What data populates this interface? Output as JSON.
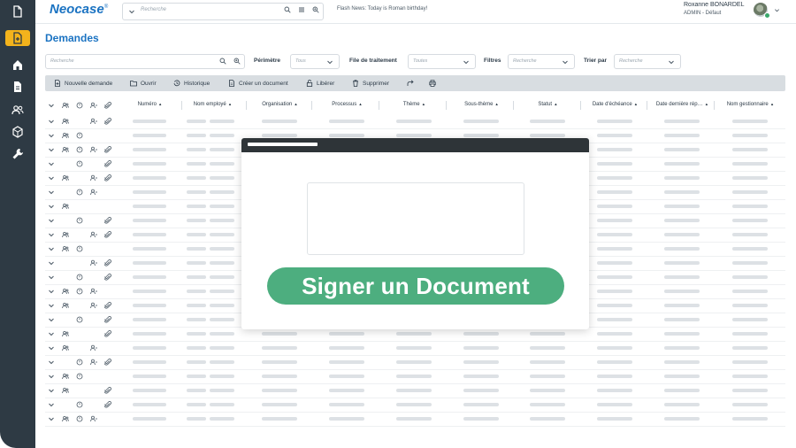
{
  "app": {
    "logo": "Neocase",
    "logo_mark": "®",
    "top_search_placeholder": "Recherche",
    "flash_news": "Flash News: Today is Roman birthday!",
    "user_name": "Roxanne  BONARDEL",
    "user_role": "ADMIN - Défaut"
  },
  "page": {
    "title": "Demandes",
    "search_placeholder": "Recherche"
  },
  "filters": {
    "perimetre_label": "Périmètre",
    "perimetre_value": "Tous",
    "file_label": "File de traitement",
    "file_value": "Toutes",
    "filtres_label": "Filtres",
    "filtres_value": "Recherche",
    "trier_label": "Trier par",
    "trier_value": "Recherche"
  },
  "toolbar": {
    "new_label": "Nouvelle demande",
    "open_label": "Ouvrir",
    "history_label": "Historique",
    "create_doc_label": "Créer un document",
    "release_label": "Libérer",
    "delete_label": "Supprimer"
  },
  "table": {
    "columns": [
      "Numéro",
      "Nom employé",
      "Organisation",
      "Processus",
      "Thème",
      "Sous-thème",
      "Statut",
      "Date d'échéance",
      "Date dernière rép…",
      "Nom gestionnaire"
    ],
    "sort_glyph": "▲▼"
  },
  "modal": {
    "button_label": "Signer un Document"
  },
  "colors": {
    "sidebar": "#2e3a44",
    "accent": "#1b73c2",
    "active_nav": "#f3b31c",
    "sign_button": "#4dae7f"
  },
  "icons": {
    "sidebar": [
      "document-icon",
      "add-document-icon",
      "home-icon",
      "file-icon",
      "users-icon",
      "cube-icon",
      "wrench-icon"
    ]
  }
}
